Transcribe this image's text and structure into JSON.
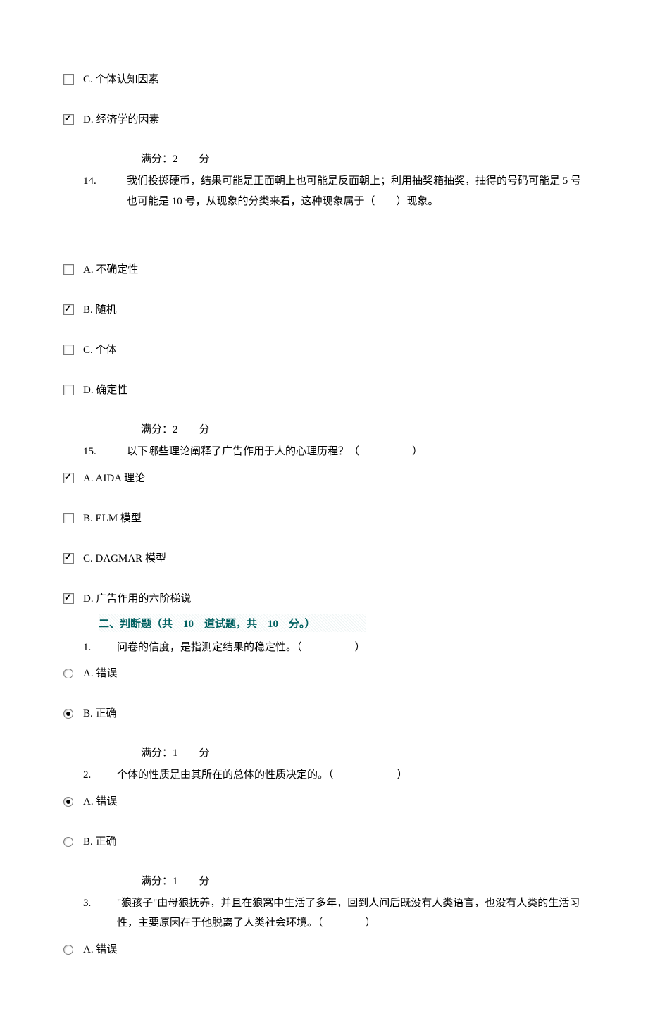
{
  "q13_continued": {
    "options": [
      {
        "letter": "C.",
        "label": "个体认知因素",
        "checked": false
      },
      {
        "letter": "D.",
        "label": "经济学的因素",
        "checked": true
      }
    ]
  },
  "q13_score": "满分：2　　分",
  "q14": {
    "num": "14.",
    "text": "我们投掷硬币，结果可能是正面朝上也可能是反面朝上；利用抽奖箱抽奖，抽得的号码可能是 5 号也可能是 10 号，从现象的分类来看，这种现象属于（　　）现象。",
    "options": [
      {
        "letter": "A.",
        "label": "不确定性",
        "checked": false
      },
      {
        "letter": "B.",
        "label": "随机",
        "checked": true
      },
      {
        "letter": "C.",
        "label": "个体",
        "checked": false
      },
      {
        "letter": "D.",
        "label": "确定性",
        "checked": false
      }
    ]
  },
  "q14_score": "满分：2　　分",
  "q15": {
    "num": "15.",
    "text": "以下哪些理论阐释了广告作用于人的心理历程？（　　　　　）",
    "options": [
      {
        "letter": "A.",
        "label": "AIDA 理论",
        "checked": true
      },
      {
        "letter": "B.",
        "label": "ELM 模型",
        "checked": false
      },
      {
        "letter": "C.",
        "label": "DAGMAR 模型",
        "checked": true
      },
      {
        "letter": "D.",
        "label": "广告作用的六阶梯说",
        "checked": true
      }
    ]
  },
  "section2": {
    "header": "二、判断题（共　10　道试题，共　10　分。）"
  },
  "j1": {
    "num": "1.",
    "text": "问卷的信度，是指测定结果的稳定性。（　　　　　）",
    "options": [
      {
        "letter": "A.",
        "label": "错误",
        "checked": false
      },
      {
        "letter": "B.",
        "label": "正确",
        "checked": true
      }
    ]
  },
  "j1_score": "满分：1　　分",
  "j2": {
    "num": "2.",
    "text": "个体的性质是由其所在的总体的性质决定的。（　　　　　　）",
    "options": [
      {
        "letter": "A.",
        "label": "错误",
        "checked": true
      },
      {
        "letter": "B.",
        "label": "正确",
        "checked": false
      }
    ]
  },
  "j2_score": "满分：1　　分",
  "j3": {
    "num": "3.",
    "text": "\"狼孩子\"由母狼抚养，并且在狼窝中生活了多年，回到人间后既没有人类语言，也没有人类的生活习性，主要原因在于他脱离了人类社会环境。（　　　　）",
    "options": [
      {
        "letter": "A.",
        "label": "错误",
        "checked": false
      }
    ]
  }
}
